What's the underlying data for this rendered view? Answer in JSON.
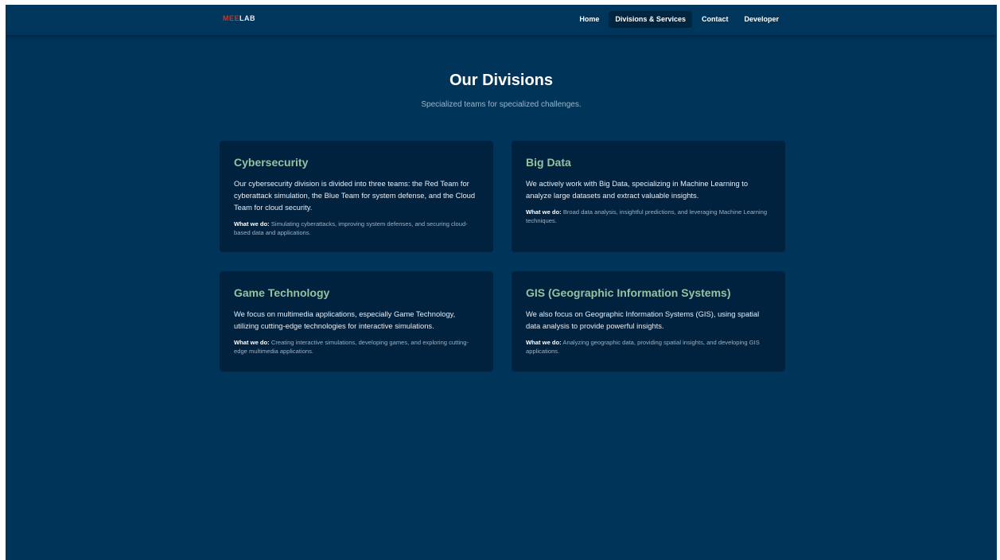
{
  "nav": {
    "logo_accent": "MEE",
    "logo_rest": "LAB",
    "links": [
      {
        "label": "Home"
      },
      {
        "label": "Divisions & Services",
        "active": true
      },
      {
        "label": "Contact"
      },
      {
        "label": "Developer"
      }
    ]
  },
  "hero": {
    "title": "Our Divisions",
    "subtitle": "Specialized teams for specialized challenges."
  },
  "divisions": [
    {
      "title": "Cybersecurity",
      "description": "Our cybersecurity division is divided into three teams: the Red Team for cyberattack simulation, the Blue Team for system defense, and the Cloud Team for cloud security.",
      "what_label": "What we do:",
      "what_text": " Simulating cyberattacks, improving system defenses, and securing cloud-based data and applications."
    },
    {
      "title": "Big Data",
      "description": "We actively work with Big Data, specializing in Machine Learning to analyze large datasets and extract valuable insights.",
      "what_label": "What we do:",
      "what_text": " Broad data analysis, insightful predictions, and leveraging Machine Learning techniques."
    },
    {
      "title": "Game Technology",
      "description": "We focus on multimedia applications, especially Game Technology, utilizing cutting-edge technologies for interactive simulations.",
      "what_label": "What we do:",
      "what_text": " Creating interactive simulations, developing games, and exploring cutting-edge multimedia applications."
    },
    {
      "title": "GIS (Geographic Information Systems)",
      "description": "We also focus on Geographic Information Systems (GIS), using spatial data analysis to provide powerful insights.",
      "what_label": "What we do:",
      "what_text": " Analyzing geographic data, providing spatial insights, and developing GIS applications."
    }
  ],
  "colors": {
    "background": "#003459",
    "card": "#00223f",
    "card_title": "#93c3a1",
    "logo_accent": "#c0392b"
  }
}
